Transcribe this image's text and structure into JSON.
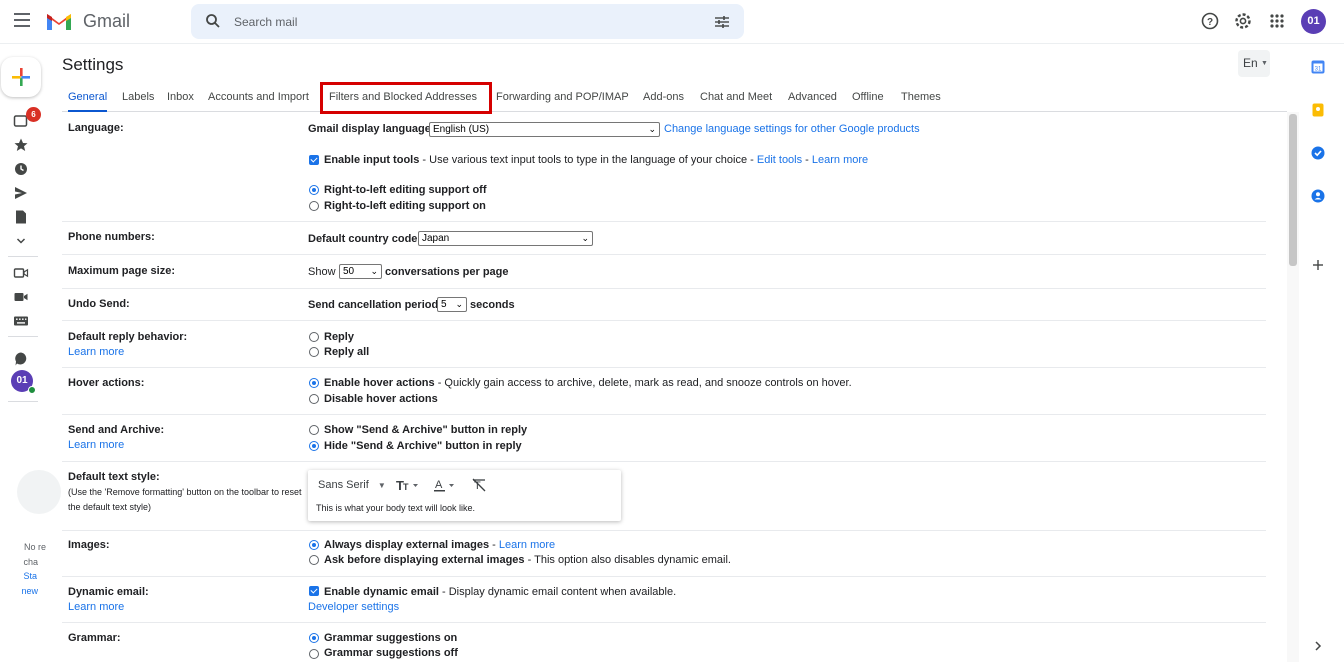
{
  "app": {
    "brand": "Gmail",
    "accent": "#0b57d0",
    "highlight_color": "#d50000"
  },
  "header": {
    "search_placeholder": "Search mail",
    "avatar_initials": "01",
    "icons": [
      "menu-icon",
      "help-icon",
      "gear-icon",
      "apps-icon"
    ]
  },
  "rail": {
    "badge_count": "6",
    "avatar_initials": "01",
    "chat_text": [
      "No re",
      "cha",
      "Sta",
      "new"
    ]
  },
  "settings": {
    "title": "Settings",
    "language_button": "En",
    "tabs": [
      "General",
      "Labels",
      "Inbox",
      "Accounts and Import",
      "Filters and Blocked Addresses",
      "Forwarding and POP/IMAP",
      "Add-ons",
      "Chat and Meet",
      "Advanced",
      "Offline",
      "Themes"
    ],
    "active_tab": "General",
    "highlighted_tab": "Filters and Blocked Addresses"
  },
  "rows": {
    "language": {
      "label": "Language:",
      "display_label": "Gmail display language:",
      "display_value": "English (US)",
      "change_link": "Change language settings for other Google products",
      "input_tools_bold": "Enable input tools",
      "input_tools_desc": " - Use various text input tools to type in the language of your choice - ",
      "edit_tools": "Edit tools",
      "dash": " - ",
      "learn_more": "Learn more",
      "rtl_off": "Right-to-left editing support off",
      "rtl_on": "Right-to-left editing support on"
    },
    "phone": {
      "label": "Phone numbers:",
      "country_label": "Default country code:",
      "country_value": "Japan"
    },
    "page_size": {
      "label": "Maximum page size:",
      "show": "Show",
      "value": "50",
      "suffix": "conversations per page"
    },
    "undo": {
      "label": "Undo Send:",
      "prefix": "Send cancellation period:",
      "value": "5",
      "suffix": "seconds"
    },
    "reply": {
      "label": "Default reply behavior:",
      "learn_more": "Learn more",
      "opt1": "Reply",
      "opt2": "Reply all"
    },
    "hover": {
      "label": "Hover actions:",
      "opt1_bold": "Enable hover actions",
      "opt1_desc": " - Quickly gain access to archive, delete, mark as read, and snooze controls on hover.",
      "opt2": "Disable hover actions"
    },
    "send_archive": {
      "label": "Send and Archive:",
      "learn_more": "Learn more",
      "opt1": "Show \"Send & Archive\" button in reply",
      "opt2": "Hide \"Send & Archive\" button in reply"
    },
    "text_style": {
      "label": "Default text style:",
      "sub": "(Use the 'Remove formatting' button on the toolbar to reset the default text style)",
      "font": "Sans Serif",
      "sample": "This is what your body text will look like."
    },
    "images": {
      "label": "Images:",
      "opt1_bold": "Always display external images",
      "opt1_dash": " - ",
      "opt1_link": "Learn more",
      "opt2_bold": "Ask before displaying external images",
      "opt2_desc": " - This option also disables dynamic email."
    },
    "dynamic": {
      "label": "Dynamic email:",
      "learn_more": "Learn more",
      "opt_bold": "Enable dynamic email",
      "opt_desc": " - Display dynamic email content when available.",
      "dev_link": "Developer settings"
    },
    "grammar": {
      "label": "Grammar:",
      "opt1": "Grammar suggestions on",
      "opt2": "Grammar suggestions off"
    }
  }
}
